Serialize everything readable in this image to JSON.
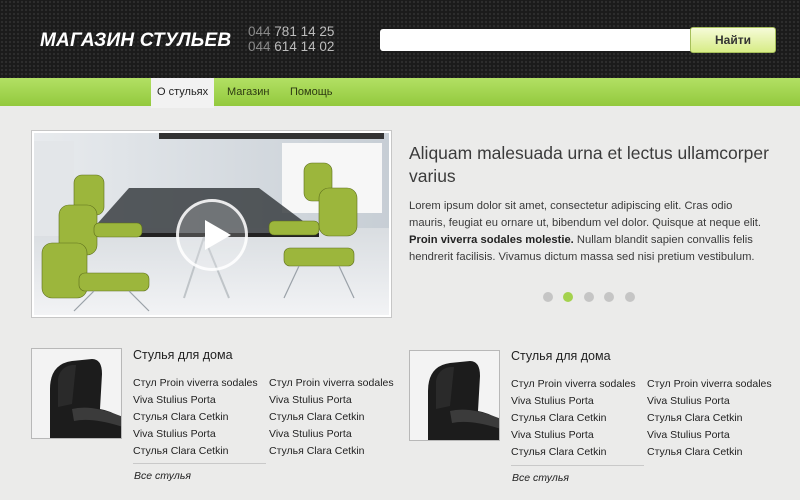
{
  "header": {
    "logo": "МАГАЗИН СТУЛЬЕВ",
    "phone_prefix": "044",
    "phones": [
      "781 14 25",
      "614 14 02"
    ],
    "search_placeholder": "",
    "search_button": "Найти"
  },
  "nav": {
    "items": [
      {
        "label": "О стульях",
        "active": true
      },
      {
        "label": "Магазин",
        "active": false
      },
      {
        "label": "Помощь",
        "active": false
      }
    ]
  },
  "hero": {
    "title": "Aliquam malesuada urna et lectus ullamcorper varius",
    "text_before": "Lorem ipsum dolor sit amet, consectetur adipiscing elit. Cras odio mauris, feugiat eu ornare ut, bibendum vel dolor. Quisque at neque elit. ",
    "text_bold": "Proin viverra sodales molestie.",
    "text_after": " Nullam blandit sapien convallis felis hendrerit facilisis. Vivamus dictum massa sed nisi pretium vesti­bulum.",
    "slides": 5,
    "active_slide": 2
  },
  "products": [
    {
      "title": "Стулья для дома",
      "col1": [
        "Стул Proin viverra sodales",
        "Viva Stulius Porta",
        "Стулья Clara Cetkin",
        "Viva Stulius Porta",
        "Стулья Clara Cetkin"
      ],
      "col2": [
        "Стул Proin viverra sodales",
        "Viva Stulius Porta",
        "Стулья Clara Cetkin",
        "Viva Stulius Porta",
        "Стулья Clara Cetkin"
      ],
      "all_link": "Все стулья"
    },
    {
      "title": "Стулья для дома",
      "col1": [
        "Стул Proin viverra sodales",
        "Viva Stulius Porta",
        "Стулья Clara Cetkin",
        "Viva Stulius Porta",
        "Стулья Clara Cetkin"
      ],
      "col2": [
        "Стул Proin viverra sodales",
        "Viva Stulius Porta",
        "Стулья Clara Cetkin",
        "Viva Stulius Porta",
        "Стулья Clara Cetkin"
      ],
      "all_link": "Все стулья"
    }
  ],
  "colors": {
    "accent": "#a4d24e",
    "header_bg": "#1b1b1b",
    "page_bg": "#ebebea"
  }
}
